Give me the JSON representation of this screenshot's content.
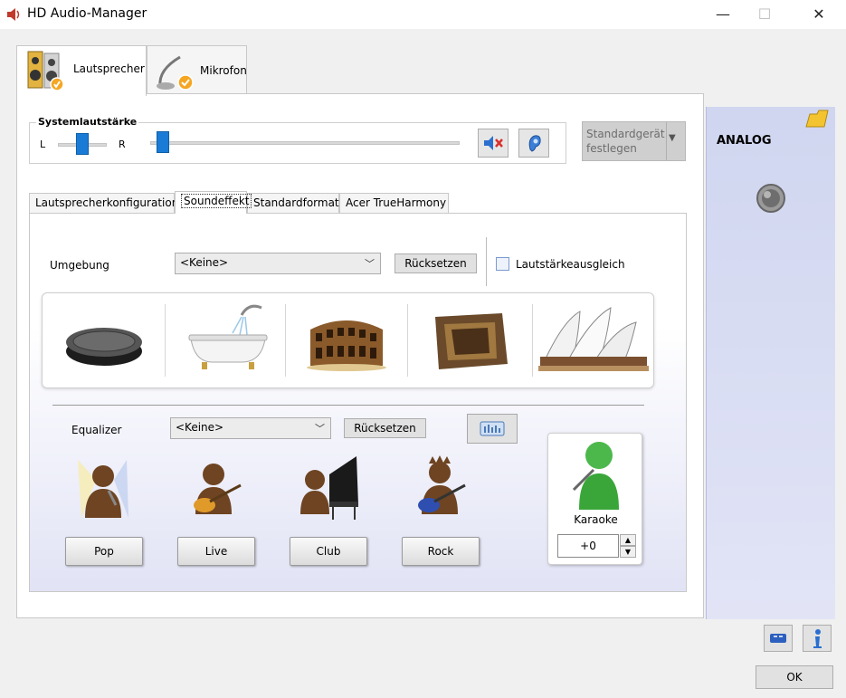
{
  "window": {
    "title": "HD Audio-Manager"
  },
  "main_tabs": [
    {
      "label": "Lautsprecher",
      "active": true
    },
    {
      "label": "Mikrofon",
      "active": false
    }
  ],
  "volume": {
    "group_label": "Systemlautstärke",
    "left_label": "L",
    "right_label": "R",
    "balance": 0.5,
    "level": 0.02
  },
  "default_device": {
    "label_line1": "Standardgerät",
    "label_line2": "festlegen"
  },
  "analog": {
    "title": "ANALOG"
  },
  "sub_tabs": [
    {
      "label": "Lautsprecherkonfiguration",
      "active": false
    },
    {
      "label": "Soundeffekt",
      "active": true
    },
    {
      "label": "Standardformat",
      "active": false
    },
    {
      "label": "Acer TrueHarmony",
      "active": false
    }
  ],
  "environment": {
    "label": "Umgebung",
    "selected": "<Keine>",
    "reset_label": "Rücksetzen",
    "loudness_label": "Lautstärkeausgleich",
    "loudness_checked": false
  },
  "equalizer": {
    "label": "Equalizer",
    "selected": "<Keine>",
    "reset_label": "Rücksetzen",
    "presets": [
      "Pop",
      "Live",
      "Club",
      "Rock"
    ]
  },
  "karaoke": {
    "label": "Karaoke",
    "value": "+0"
  },
  "footer": {
    "ok_label": "OK"
  },
  "colors": {
    "accent": "#1a7bd6",
    "panel_blue": "#d0d6f0"
  }
}
